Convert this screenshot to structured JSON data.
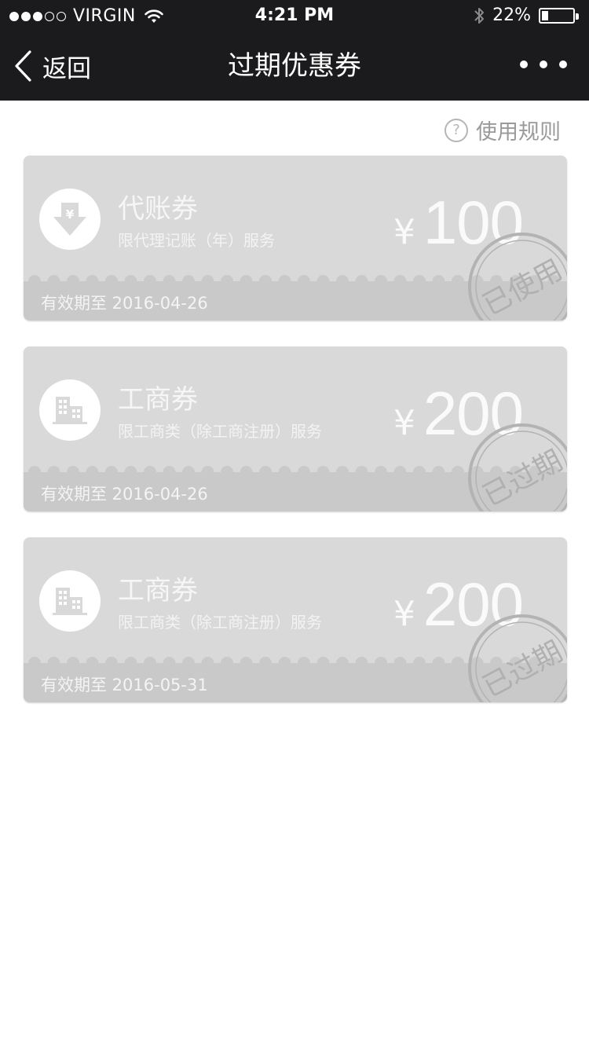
{
  "status_bar": {
    "carrier": "VIRGIN",
    "time": "4:21 PM",
    "battery": "22%",
    "battery_level": 0.22,
    "signal_bars": 3
  },
  "nav": {
    "back_label": "返回",
    "title": "过期优惠券"
  },
  "rules": {
    "icon": "?",
    "label": "使用规则"
  },
  "colors": {
    "nav_bg": "#1b1b1d",
    "card_bg": "#d9d9d9",
    "card_footer": "#c9c9c9",
    "stamp": "#b0b0b0"
  },
  "coupons": [
    {
      "icon": "yen-down-icon",
      "name": "代账券",
      "description": "限代理记账（年）服务",
      "currency": "¥",
      "amount": "100",
      "validity": "有效期至 2016-04-26",
      "stamp": "已使用"
    },
    {
      "icon": "building-icon",
      "name": "工商券",
      "description": "限工商类（除工商注册）服务",
      "currency": "¥",
      "amount": "200",
      "validity": "有效期至 2016-04-26",
      "stamp": "已过期"
    },
    {
      "icon": "building-icon",
      "name": "工商券",
      "description": "限工商类（除工商注册）服务",
      "currency": "¥",
      "amount": "200",
      "validity": "有效期至 2016-05-31",
      "stamp": "已过期"
    }
  ]
}
